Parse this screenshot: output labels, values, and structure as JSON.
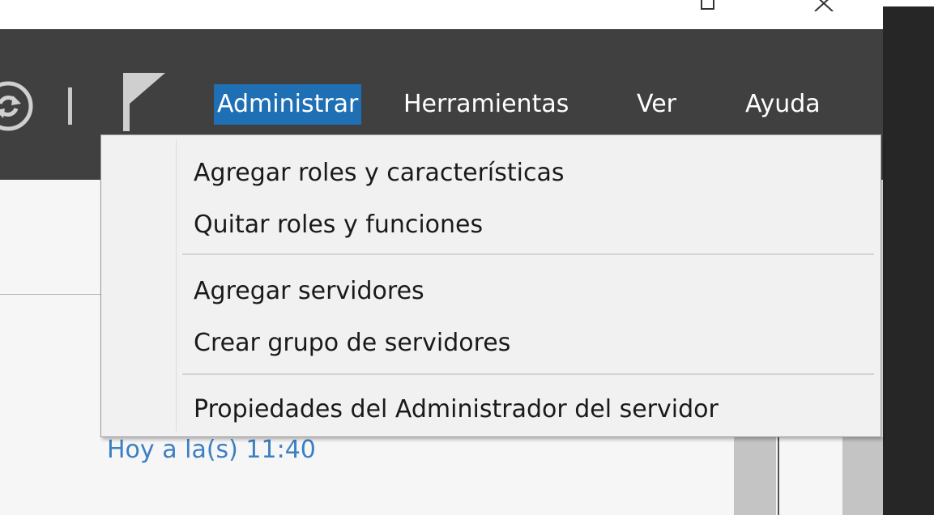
{
  "window": {
    "maximize_icon": "maximize-icon",
    "close_icon": "close-icon"
  },
  "toolbar": {
    "refresh_icon": "refresh-icon",
    "notifications_icon": "flag-icon"
  },
  "menubar": {
    "items": [
      {
        "label": "Administrar",
        "selected": true
      },
      {
        "label": "Herramientas",
        "selected": false
      },
      {
        "label": "Ver",
        "selected": false
      },
      {
        "label": "Ayuda",
        "selected": false
      }
    ],
    "selected_color": "#1e6fb4",
    "background_color": "#404040"
  },
  "dropdown": {
    "items": [
      {
        "label": "Agregar roles y características"
      },
      {
        "label": "Quitar roles y funciones"
      },
      {
        "label": "Agregar servidores"
      },
      {
        "label": "Crear grupo de servidores"
      },
      {
        "label": "Propiedades del Administrador del servidor"
      }
    ]
  },
  "content": {
    "timestamp": "Hoy a la(s) 11:40",
    "link_color": "#3c7fc4"
  }
}
